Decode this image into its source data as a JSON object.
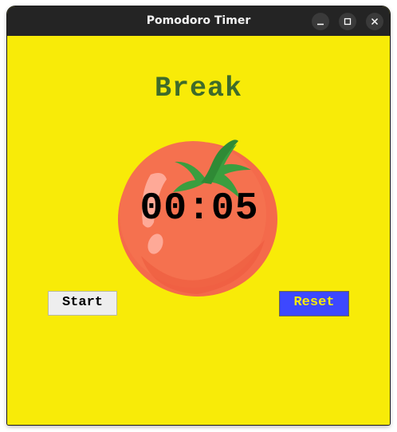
{
  "window": {
    "title": "Pomodoro Timer",
    "controls": {
      "minimize_icon": "minimize-icon",
      "maximize_icon": "maximize-icon",
      "close_icon": "close-icon"
    }
  },
  "app": {
    "mode_label": "Break",
    "timer_text": "00:05",
    "start_label": "Start",
    "reset_label": "Reset",
    "image_icon": "tomato-icon"
  },
  "colors": {
    "background": "#f8eb08",
    "titlebar": "#242424",
    "mode_label": "#3f6b2a",
    "tomato_body": "#f46a4b",
    "tomato_leaves": "#3a9e3f",
    "reset_button_bg": "#3d48ff",
    "reset_button_text": "#f8eb08",
    "start_button_bg": "#eeeeee"
  }
}
